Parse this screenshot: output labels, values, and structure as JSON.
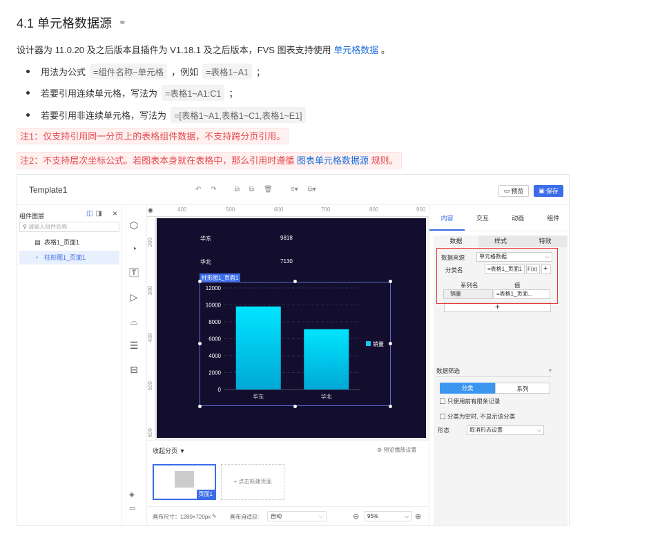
{
  "heading": {
    "title": "4.1 单元格数据源",
    "icon": "link-icon"
  },
  "intro": {
    "text": "设计器为 11.0.20 及之后版本且插件为 V1.18.1 及之后版本，FVS 图表支持使用",
    "link": "单元格数据",
    "tail": "。"
  },
  "bullets": [
    {
      "text": "用法为公式",
      "code": "=组件名称~单元格",
      "text2": "，例如",
      "code2": "=表格1~A1",
      "tail": "；"
    },
    {
      "text": "若要引用连续单元格，写法为",
      "code": "=表格1~A1:C1",
      "tail": "；"
    },
    {
      "text": "若要引用非连续单元格，写法为",
      "code": "=[表格1~A1,表格1~C1,表格1~E1]",
      "tail": ""
    }
  ],
  "notes": {
    "note1": "注1：仅支持引用同一分页上的表格组件数据，不支持跨分页引用。",
    "note2_pre": "注2：不支持层次坐标公式。若图表本身就在表格中，那么引用时遵循",
    "note2_link": "图表单元格数据源",
    "note2_post": "规则。"
  },
  "app": {
    "title": "Template1",
    "toolbar": {
      "undo": "↶",
      "redo": "↷",
      "copy": "⧉",
      "paste": "⧉",
      "delete": "🗑",
      "align": "≡▾",
      "layer": "⧉▾"
    },
    "preview_label": "预览",
    "save_label": "保存",
    "layers": {
      "title": "组件图层",
      "search_placeholder": "请输入组件名称",
      "items": [
        {
          "label": "表格1_页面1",
          "icon": "table-icon"
        },
        {
          "label": "柱形图1_页面1",
          "icon": "chart-icon"
        }
      ]
    },
    "iconbar": [
      "cube-icon",
      "pie-icon",
      "text-icon",
      "video-icon",
      "box-icon",
      "list-icon",
      "archive-icon"
    ],
    "rulers": {
      "top": [
        "400",
        "500",
        "600",
        "700",
        "800",
        "900"
      ],
      "left": [
        "200",
        "300",
        "400",
        "500",
        "600"
      ]
    },
    "stage": {
      "table": [
        {
          "name": "华东",
          "value": "9818"
        },
        {
          "name": "华北",
          "value": "7130"
        }
      ],
      "chart_tag": "柱形图1_页面1"
    },
    "pages": {
      "collapse": "收起分页",
      "preview_settings": "预览播放设置",
      "page_tag": "页面1",
      "new_page": "+ 点击新建页面"
    },
    "status": {
      "size_label": "画布尺寸：1280×720px",
      "adapt_label": "画布自适应:",
      "adapt_value": "自动",
      "zoom": "95%"
    },
    "right_panel": {
      "tabs": [
        "内容",
        "交互",
        "动画",
        "组件"
      ],
      "sub_tabs": [
        "数据",
        "样式",
        "特效"
      ],
      "data_source_label": "数据来源",
      "data_source_value": "单元格数据",
      "category_label": "分类名",
      "category_value": "=表格1_页面1",
      "fx": "F(x)",
      "series_header": "系列名",
      "value_header": "值",
      "series_name": "销量",
      "series_value": "=表格1_页面...",
      "filter_title": "数据筛选",
      "seg_category": "分类",
      "seg_series": "系列",
      "chk_before": "只使用前有限条记录",
      "chk_empty": "分类为空时, 不显示该分类",
      "form_label": "形态",
      "form_value": "取消形态设置"
    }
  },
  "chart_data": {
    "type": "bar",
    "categories": [
      "华东",
      "华北"
    ],
    "series": [
      {
        "name": "销量",
        "values": [
          9818,
          7130
        ]
      }
    ],
    "ylim": [
      0,
      12000
    ],
    "yticks": [
      "0",
      "2000",
      "4000",
      "6000",
      "8000",
      "10000",
      "12000"
    ],
    "legend": "right",
    "grid": true,
    "colors": {
      "bar_top": "#00e5ff",
      "bar_bottom": "#00a8d6",
      "legend": "#14c8ef"
    }
  }
}
